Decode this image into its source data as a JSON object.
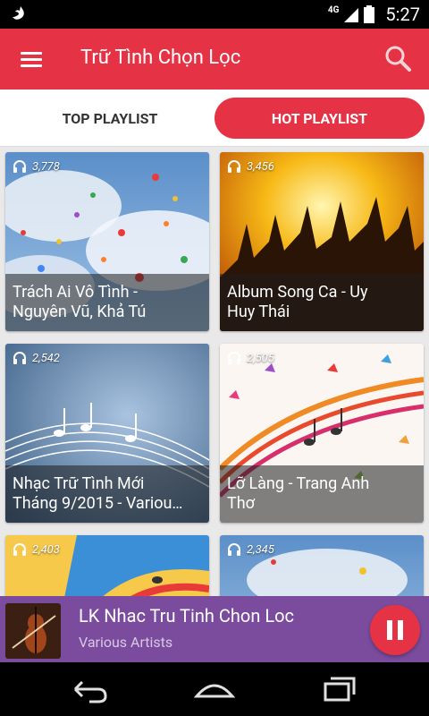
{
  "status_bar": {
    "network": "4G",
    "time": "5:27"
  },
  "app_bar": {
    "title": "Trữ Tình Chọn Lọc",
    "menu_icon": "hamburger-menu-icon",
    "search_icon": "search-icon"
  },
  "tabs": [
    {
      "label": "TOP PLAYLIST",
      "selected": false
    },
    {
      "label": "HOT PLAYLIST",
      "selected": true
    }
  ],
  "playlists": [
    {
      "plays": "3,778",
      "line1": "Trách Ai Vô Tình -",
      "line2": "Nguyên Vũ, Khả Tú"
    },
    {
      "plays": "3,456",
      "line1": "Album Song Ca - Uy",
      "line2": "Huy Thái"
    },
    {
      "plays": "2,542",
      "line1": "Nhạc Trữ Tình Mới",
      "line2": "Tháng 9/2015 - Variou…"
    },
    {
      "plays": "2,505",
      "line1": "Lỡ Làng - Trang Anh",
      "line2": "Thơ"
    },
    {
      "plays": "2,403",
      "line1": "",
      "line2": ""
    },
    {
      "plays": "2,345",
      "line1": "",
      "line2": ""
    }
  ],
  "now_playing": {
    "title": "LK Nhac Tru Tinh Chon Loc",
    "artist": "Various Artists",
    "state": "playing"
  },
  "colors": {
    "primary": "#e53345",
    "player_bg": "#7b4c9e"
  }
}
